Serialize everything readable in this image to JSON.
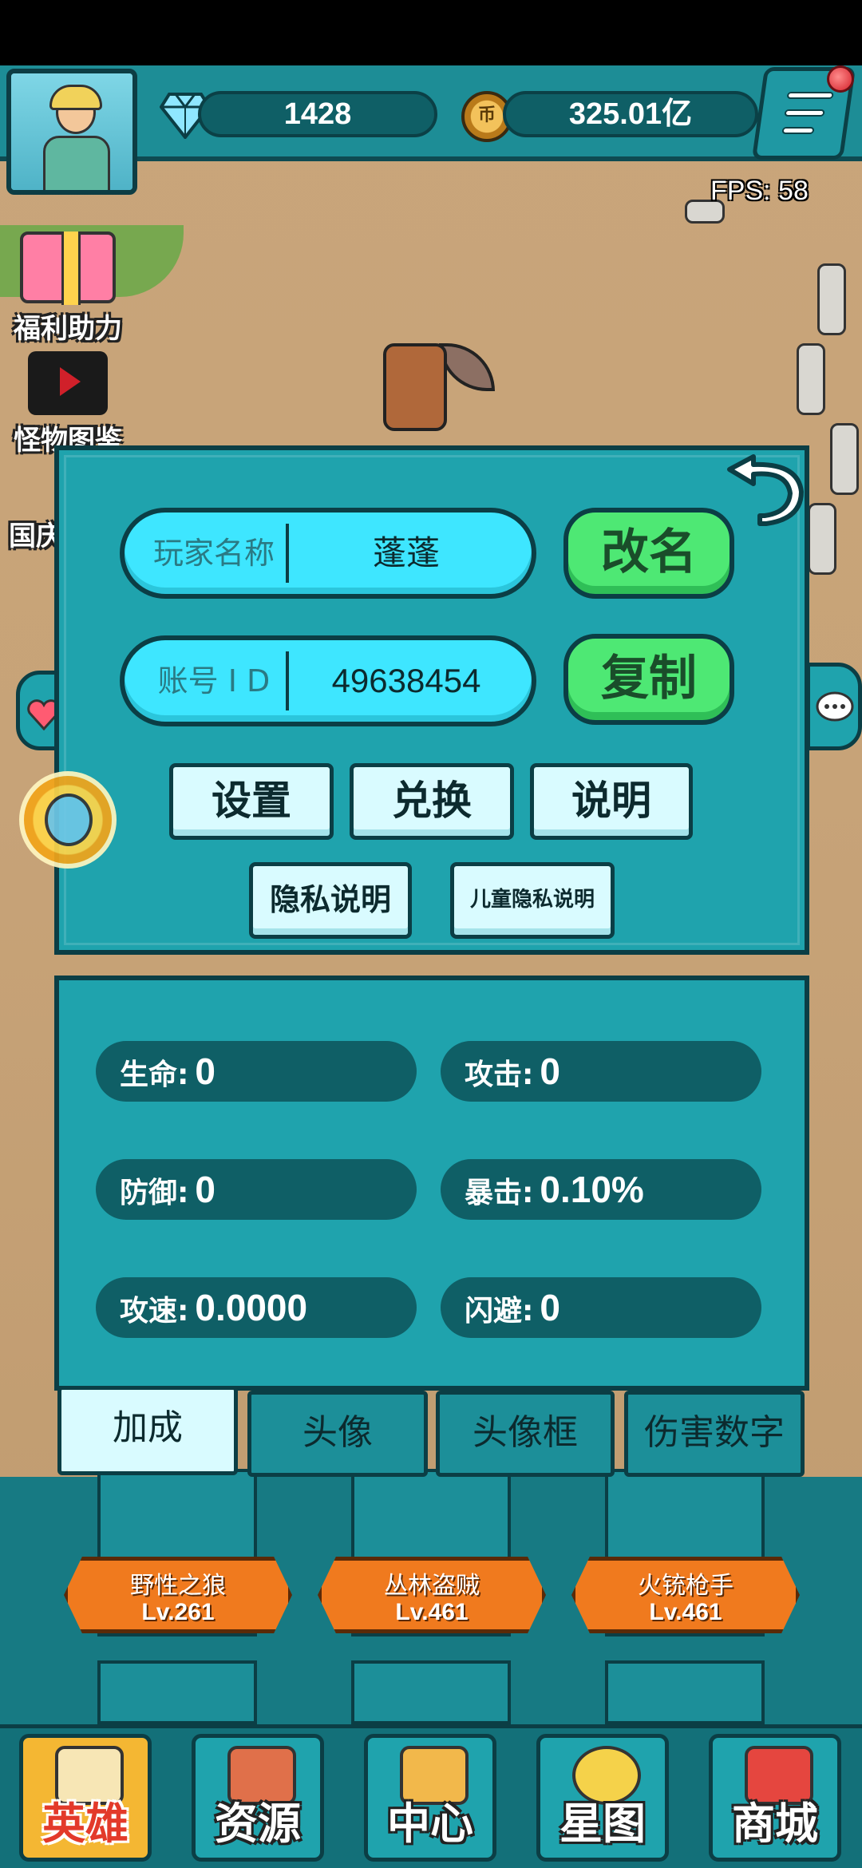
{
  "resources": {
    "gems": "1428",
    "coins": "325.01亿",
    "gem_icon": "diamond-icon",
    "coin_icon": "coin-icon"
  },
  "fps": {
    "label": "FPS:",
    "value": "58"
  },
  "side_menu": [
    {
      "label": "福利助力",
      "icon": "gift-icon"
    },
    {
      "label": "怪物图鉴",
      "icon": "monster-book-icon"
    },
    {
      "label": "国庆",
      "icon": "event-icon"
    }
  ],
  "profile": {
    "name_label": "玩家名称",
    "name_value": "蓬蓬",
    "rename_button": "改名",
    "id_label": "账号 I D",
    "id_value": "49638454",
    "copy_button": "复制",
    "buttons": [
      "设置",
      "兑换",
      "说明"
    ],
    "privacy_button": "隐私说明",
    "child_privacy_button": "儿童隐私说明"
  },
  "stats": [
    {
      "label": "生命:",
      "value": "0"
    },
    {
      "label": "攻击:",
      "value": "0"
    },
    {
      "label": "防御:",
      "value": "0"
    },
    {
      "label": "暴击:",
      "value": "0.10%"
    },
    {
      "label": "攻速:",
      "value": "0.0000"
    },
    {
      "label": "闪避:",
      "value": "0"
    }
  ],
  "tabs": [
    {
      "label": "加成",
      "active": true
    },
    {
      "label": "头像",
      "active": false
    },
    {
      "label": "头像框",
      "active": false
    },
    {
      "label": "伤害数字",
      "active": false
    }
  ],
  "heroes": [
    {
      "name": "野性之狼",
      "level": "Lv.261"
    },
    {
      "name": "丛林盗贼",
      "level": "Lv.461"
    },
    {
      "name": "火铳枪手",
      "level": "Lv.461"
    }
  ],
  "bottom_nav": [
    {
      "label": "英雄",
      "active": true
    },
    {
      "label": "资源",
      "active": false
    },
    {
      "label": "中心",
      "active": false
    },
    {
      "label": "星图",
      "active": false
    },
    {
      "label": "商城",
      "active": false
    }
  ],
  "colors": {
    "panel": "#1fa3ad",
    "field": "#3ee6ff",
    "green_button": "#4ee874",
    "dark_outline": "#0b3e45"
  }
}
